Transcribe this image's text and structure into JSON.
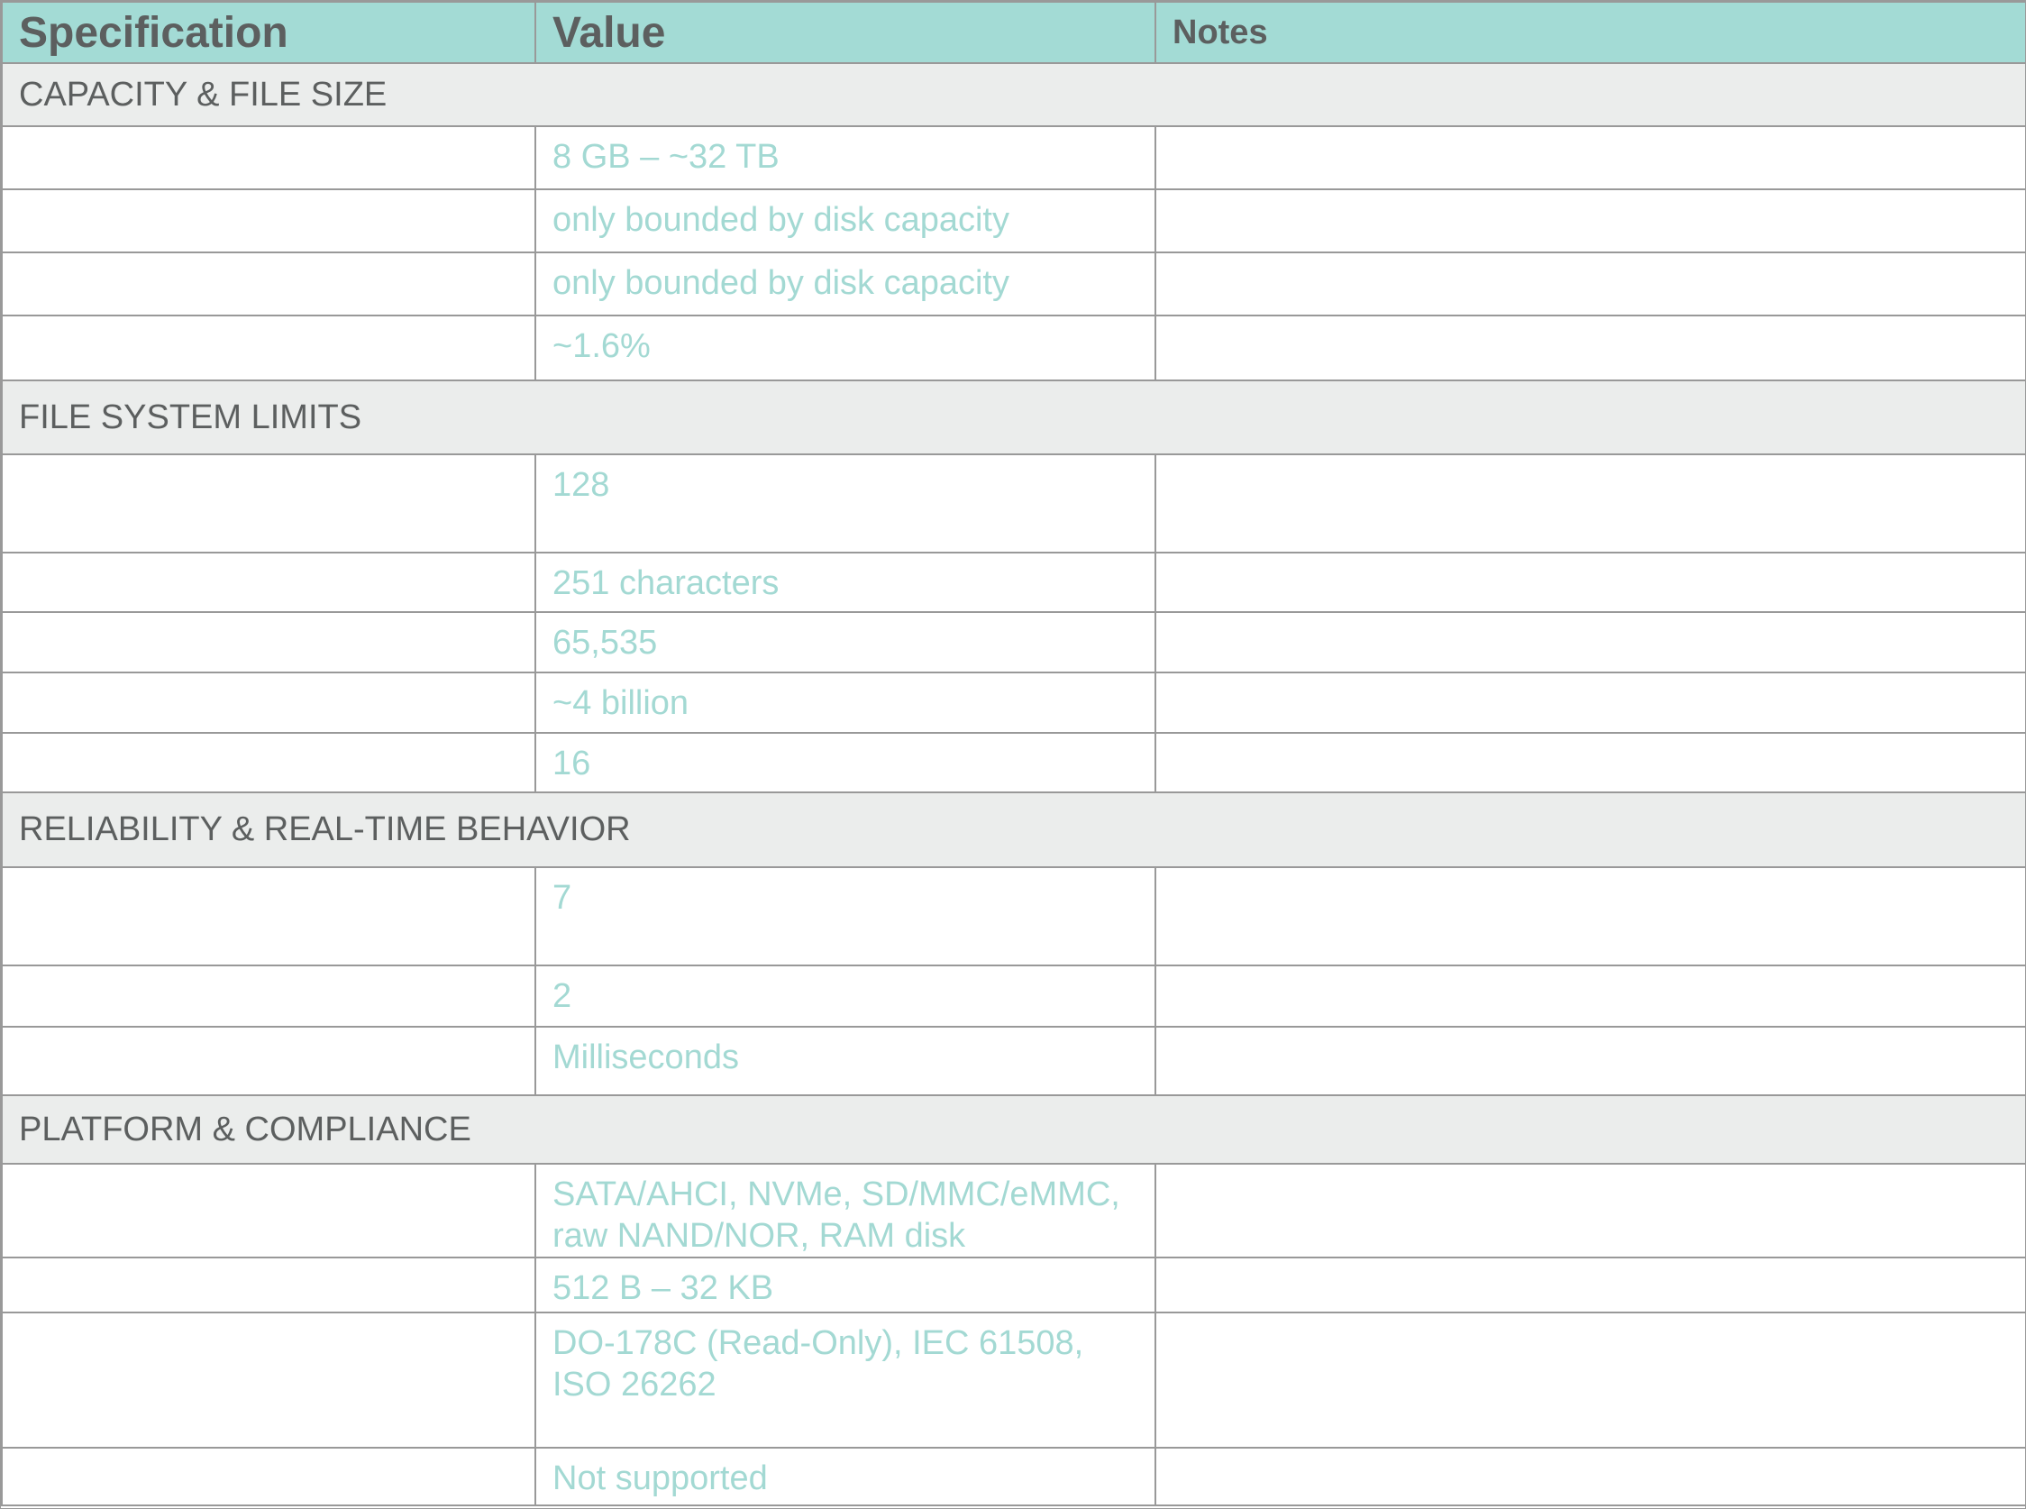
{
  "headers": {
    "spec": "Specification",
    "value": "Value",
    "notes": "Notes"
  },
  "sections": [
    {
      "title": "CAPACITY & FILE SIZE",
      "rows": [
        {
          "spec": "",
          "value": "8 GB – ~32 TB",
          "notes": ""
        },
        {
          "spec": "",
          "value": "only bounded by disk capacity",
          "notes": ""
        },
        {
          "spec": "",
          "value": "only bounded by disk capacity",
          "notes": ""
        },
        {
          "spec": "",
          "value": "~1.6%",
          "notes": ""
        }
      ]
    },
    {
      "title": "FILE SYSTEM LIMITS",
      "rows": [
        {
          "spec": "",
          "value": "128",
          "notes": ""
        },
        {
          "spec": "",
          "value": "251 characters",
          "notes": ""
        },
        {
          "spec": "",
          "value": "65,535",
          "notes": ""
        },
        {
          "spec": "",
          "value": "~4 billion",
          "notes": ""
        },
        {
          "spec": "",
          "value": "16",
          "notes": ""
        }
      ]
    },
    {
      "title": "RELIABILITY & REAL-TIME BEHAVIOR",
      "rows": [
        {
          "spec": "",
          "value": "7",
          "notes": ""
        },
        {
          "spec": "",
          "value": "2",
          "notes": ""
        },
        {
          "spec": "",
          "value": "Milliseconds",
          "notes": ""
        }
      ]
    },
    {
      "title": "PLATFORM & COMPLIANCE",
      "rows": [
        {
          "spec": "",
          "value": "SATA/AHCI, NVMe, SD/MMC/eMMC, raw NAND/NOR, RAM disk",
          "notes": ""
        },
        {
          "spec": "",
          "value": "512 B – 32 KB",
          "notes": ""
        },
        {
          "spec": "",
          "value": "DO-178C (Read-Only), IEC 61508, ISO 26262",
          "notes": ""
        },
        {
          "spec": "",
          "value": "Not supported",
          "notes": ""
        }
      ]
    }
  ]
}
